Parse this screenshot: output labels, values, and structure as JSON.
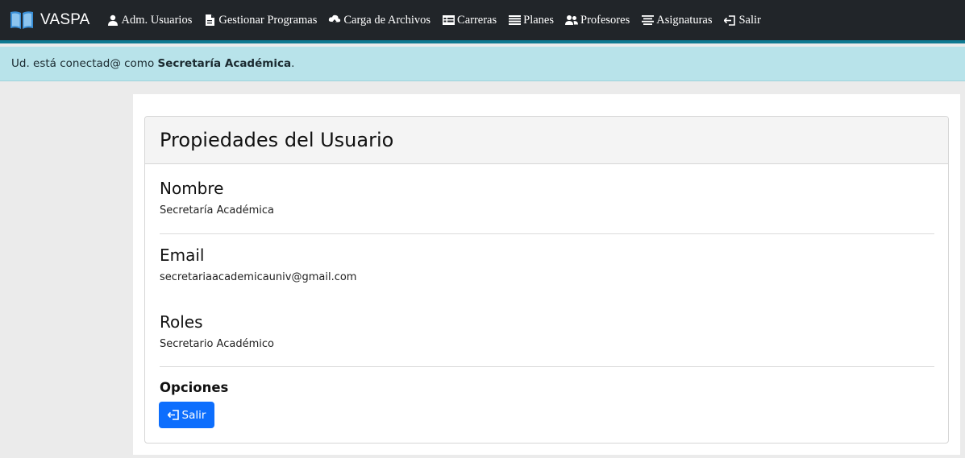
{
  "navbar": {
    "brand": "VASPA",
    "items": [
      {
        "label": "Adm. Usuarios",
        "icon": "user-icon"
      },
      {
        "label": "Gestionar Programas",
        "icon": "document-icon"
      },
      {
        "label": "Carga de Archivos",
        "icon": "cloud-upload-icon"
      },
      {
        "label": "Carreras",
        "icon": "table-icon"
      },
      {
        "label": "Planes",
        "icon": "list-icon"
      },
      {
        "label": "Profesores",
        "icon": "users-icon"
      },
      {
        "label": "Asignaturas",
        "icon": "align-icon"
      },
      {
        "label": "Salir",
        "icon": "logout-icon"
      }
    ],
    "colors": {
      "background": "#212529",
      "accent_border": "#0f7a92"
    }
  },
  "status": {
    "prefix": "Ud. está conectad@ como ",
    "user": "Secretaría Académica",
    "suffix": ".",
    "background": "#b8e3ea"
  },
  "card": {
    "title": "Propiedades del Usuario",
    "fields": [
      {
        "heading": "Nombre",
        "value": "Secretaría Académica"
      },
      {
        "heading": "Email",
        "value": "secretariaacademicauniv@gmail.com"
      },
      {
        "heading": "Roles",
        "value": "Secretario Académico"
      }
    ],
    "options_label": "Opciones",
    "exit_button": {
      "label": "Salir",
      "icon": "logout-icon",
      "color": "#0d6efd"
    }
  }
}
